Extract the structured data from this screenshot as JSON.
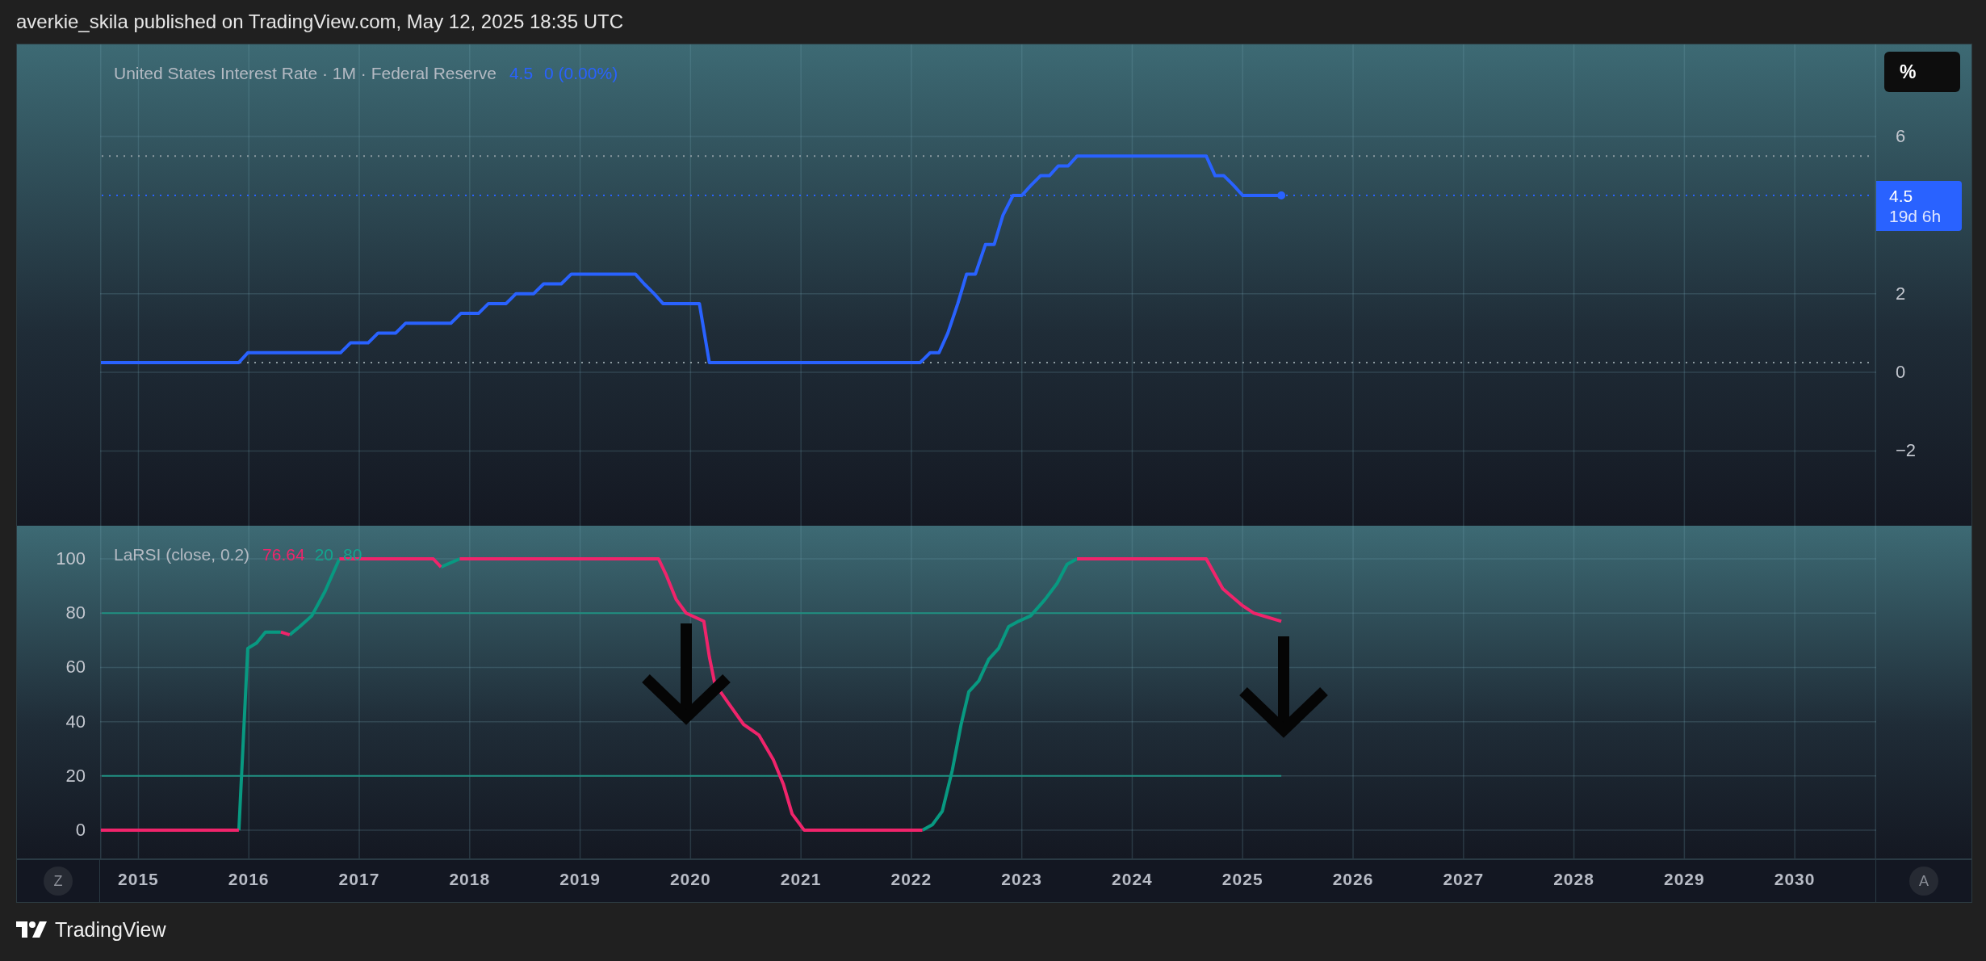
{
  "header": {
    "text": "averkie_skila published on TradingView.com, May 12, 2025 18:35 UTC"
  },
  "panes": [
    {
      "kind": "price",
      "scale_unit": "%",
      "legend": {
        "title": "United States Interest Rate · 1M · Federal Reserve",
        "value": "4.5",
        "change": "0 (0.00%)"
      },
      "price_label": {
        "value": "4.5",
        "countdown": "19d 6h"
      },
      "chart_data": {
        "type": "line",
        "grid": true,
        "xlim": [
          2013.9,
          2031.6
        ],
        "ylim": [
          -3.9,
          8.34
        ],
        "yticks": [
          {
            "value": -2,
            "label": "−2"
          },
          {
            "value": 0,
            "label": "0"
          },
          {
            "value": 2,
            "label": "2"
          },
          {
            "value": 6,
            "label": "6"
          }
        ],
        "x": [
          2014.66,
          2015.91,
          2015.99,
          2016.83,
          2016.92,
          2017.08,
          2017.17,
          2017.33,
          2017.42,
          2017.83,
          2017.92,
          2018.08,
          2018.17,
          2018.33,
          2018.42,
          2018.58,
          2018.67,
          2018.83,
          2018.92,
          2019.5,
          2019.58,
          2019.67,
          2019.75,
          2020.08,
          2020.17,
          2022.08,
          2022.17,
          2022.25,
          2022.33,
          2022.42,
          2022.5,
          2022.58,
          2022.67,
          2022.75,
          2022.83,
          2022.92,
          2023.0,
          2023.08,
          2023.17,
          2023.25,
          2023.33,
          2023.42,
          2023.5,
          2024.67,
          2024.75,
          2024.83,
          2024.92,
          2025.0,
          2025.35
        ],
        "series": [
          {
            "color": "#2962ff",
            "values": [
              0.25,
              0.25,
              0.5,
              0.5,
              0.75,
              0.75,
              1.0,
              1.0,
              1.25,
              1.25,
              1.5,
              1.5,
              1.75,
              1.75,
              2.0,
              2.0,
              2.25,
              2.25,
              2.5,
              2.5,
              2.25,
              2.0,
              1.75,
              1.75,
              0.25,
              0.25,
              0.5,
              0.5,
              1.0,
              1.75,
              2.5,
              2.5,
              3.25,
              3.25,
              4.0,
              4.5,
              4.5,
              4.75,
              5.0,
              5.0,
              5.25,
              5.25,
              5.5,
              5.5,
              5.0,
              5.0,
              4.75,
              4.5,
              4.5
            ]
          }
        ],
        "ref_lines": [
          {
            "axis": "y",
            "value": 5.5
          },
          {
            "axis": "y",
            "value": 4.5
          },
          {
            "axis": "y",
            "value": 0.25
          }
        ]
      }
    },
    {
      "kind": "oscillator",
      "legend": {
        "title": "LaRSI (close, 0.2)",
        "value": "76.64",
        "bands": [
          "20",
          "80"
        ]
      },
      "chart_data": {
        "type": "line",
        "grid": true,
        "xlim": [
          2013.9,
          2031.6
        ],
        "ylim": [
          -10.4,
          112.2
        ],
        "xticks": [
          2015,
          2016,
          2017,
          2018,
          2019,
          2020,
          2021,
          2022,
          2023,
          2024,
          2025,
          2026,
          2027,
          2028,
          2029,
          2030
        ],
        "yticks": [
          0,
          20,
          40,
          60,
          80,
          100
        ],
        "x": [
          2014.66,
          2015.91,
          2015.99,
          2016.07,
          2016.15,
          2016.29,
          2016.29,
          2016.37,
          2016.37,
          2016.46,
          2016.57,
          2016.69,
          2016.82,
          2017.67,
          2017.74,
          2017.74,
          2017.91,
          2019.71,
          2019.78,
          2019.87,
          2019.96,
          2020.12,
          2020.17,
          2020.22,
          2020.34,
          2020.48,
          2020.62,
          2020.75,
          2020.84,
          2020.92,
          2021.03,
          2022.1,
          2022.19,
          2022.28,
          2022.37,
          2022.45,
          2022.52,
          2022.61,
          2022.7,
          2022.79,
          2022.88,
          2022.97,
          2023.08,
          2023.21,
          2023.32,
          2023.41,
          2023.5,
          2024.67,
          2024.82,
          2024.99,
          2025.1,
          2025.35
        ],
        "series": [
          {
            "color": "#089981",
            "values": [
              null,
              0,
              67,
              69,
              73,
              73,
              null,
              null,
              72,
              75,
              79,
              88,
              100,
              null,
              null,
              97,
              100,
              null,
              null,
              null,
              null,
              null,
              null,
              null,
              null,
              null,
              null,
              null,
              null,
              null,
              null,
              0,
              2,
              7,
              22,
              39,
              51,
              55,
              63,
              67,
              75,
              77,
              79,
              85,
              91,
              98,
              100,
              null,
              null,
              null,
              null,
              null
            ]
          },
          {
            "color": "#f0246b",
            "values": [
              0,
              0,
              null,
              null,
              null,
              null,
              73,
              72,
              null,
              null,
              null,
              null,
              100,
              100,
              97,
              null,
              100,
              100,
              94,
              85,
              80,
              77,
              64,
              54,
              47,
              39,
              35,
              26,
              17,
              6,
              0,
              0,
              null,
              null,
              null,
              null,
              null,
              null,
              null,
              null,
              null,
              null,
              null,
              null,
              null,
              null,
              100,
              100,
              89,
              83,
              80,
              77
            ]
          }
        ],
        "ref_lines": [
          {
            "axis": "y",
            "value": 20
          },
          {
            "axis": "y",
            "value": 80
          }
        ]
      }
    }
  ],
  "time_axis": {
    "left_button": "Z",
    "right_button": "A"
  },
  "footer": {
    "logo_text": "TradingView"
  }
}
